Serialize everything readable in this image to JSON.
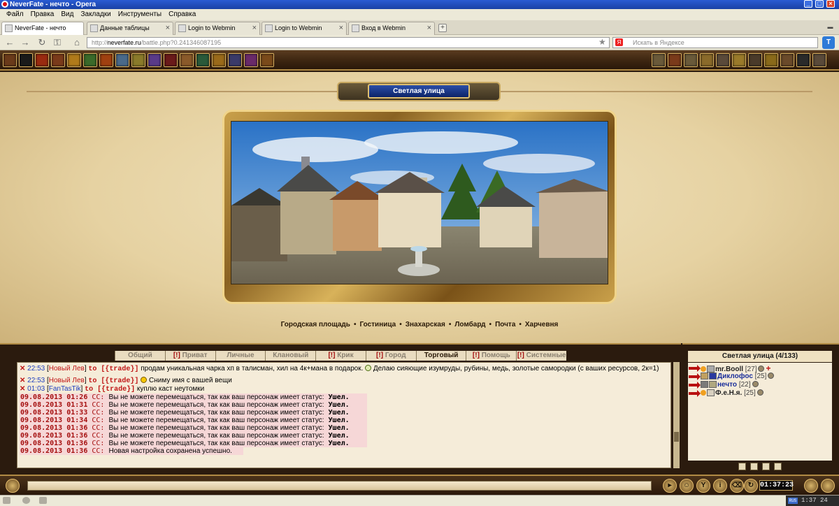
{
  "window": {
    "title": "NeverFate - нечто - Opera",
    "controls": [
      "_",
      "□",
      "×"
    ]
  },
  "menu": [
    "Файл",
    "Правка",
    "Вид",
    "Закладки",
    "Инструменты",
    "Справка"
  ],
  "tabs": [
    {
      "label": "NeverFate - нечто",
      "active": true
    },
    {
      "label": "Данные таблицы",
      "active": false
    },
    {
      "label": "Login to Webmin",
      "active": false
    },
    {
      "label": "Login to Webmin",
      "active": false
    },
    {
      "label": "Вход в Webmin",
      "active": false
    }
  ],
  "address": {
    "scheme": "http://",
    "host": "neverfate.ru",
    "path": "/battle.php?0.241346087195"
  },
  "search": {
    "placeholder": "Искать в Яндексе",
    "engine_letter": "Я"
  },
  "toolbar_button_letter": "T",
  "location": {
    "name": "Светлая улица",
    "links": [
      "Городская площадь",
      "Гостиница",
      "Знахарская",
      "Ломбард",
      "Почта",
      "Харчевня"
    ],
    "separator": "•"
  },
  "chat_tabs": [
    {
      "label": "Общий",
      "prefix": "",
      "active": false
    },
    {
      "label": "Приват",
      "prefix": "[!]",
      "active": false
    },
    {
      "label": "Личные",
      "prefix": "",
      "active": false
    },
    {
      "label": "Клановый",
      "prefix": "",
      "active": false
    },
    {
      "label": "Крик",
      "prefix": "[!]",
      "active": false
    },
    {
      "label": "Город",
      "prefix": "[!]",
      "active": false
    },
    {
      "label": "Торговый",
      "prefix": "",
      "active": true
    },
    {
      "label": "Помощь",
      "prefix": "[!]",
      "active": false
    },
    {
      "label": "Системные",
      "prefix": "[!]",
      "active": false
    }
  ],
  "chat": {
    "m1": {
      "time": "22:53",
      "nick": "Новый Лев",
      "to": "to [{trade}]",
      "text": " продам уникальная чарка хп в талисман, хил на 4к+мана в подарок. ",
      "text2": " Делаю сияющие изумруды, рубины, медь, золотые самородки (с ваших ресурсов, 2к=1) "
    },
    "m2": {
      "time": "22:53",
      "nick": "Новый Лев",
      "to": "to [{trade}]",
      "text": " Сниму имя с вашей вещи"
    },
    "m3": {
      "time": "01:03",
      "nick": "FanTasTik",
      "to": "to [{trade}]",
      "text": " куплю каст неутомки"
    },
    "system": [
      {
        "date": "09.08.2013",
        "time": "01:26",
        "tag": "CC:",
        "msg": "Вы не можете перемещаться, так как ваш персонаж имеет статус:",
        "status": "Ушел"
      },
      {
        "date": "09.08.2013",
        "time": "01:31",
        "tag": "CC:",
        "msg": "Вы не можете перемещаться, так как ваш персонаж имеет статус:",
        "status": "Ушел"
      },
      {
        "date": "09.08.2013",
        "time": "01:33",
        "tag": "CC:",
        "msg": "Вы не можете перемещаться, так как ваш персонаж имеет статус:",
        "status": "Ушел"
      },
      {
        "date": "09.08.2013",
        "time": "01:34",
        "tag": "CC:",
        "msg": "Вы не можете перемещаться, так как ваш персонаж имеет статус:",
        "status": "Ушел"
      },
      {
        "date": "09.08.2013",
        "time": "01:36",
        "tag": "CC:",
        "msg": "Вы не можете перемещаться, так как ваш персонаж имеет статус:",
        "status": "Ушел"
      },
      {
        "date": "09.08.2013",
        "time": "01:36",
        "tag": "CC:",
        "msg": "Вы не можете перемещаться, так как ваш персонаж имеет статус:",
        "status": "Ушел"
      },
      {
        "date": "09.08.2013",
        "time": "01:36",
        "tag": "CC:",
        "msg": "Вы не можете перемещаться, так как ваш персонаж имеет статус:",
        "status": "Ушел"
      },
      {
        "date": "09.08.2013",
        "time": "01:36",
        "tag": "CC:",
        "msg": "Новая настройка сохранена успешно.",
        "status": ""
      }
    ]
  },
  "users": {
    "header": "Светлая улица (4/133)",
    "list": [
      {
        "name": "mr.Booll",
        "level": "[27]",
        "name_color": "dark",
        "cross": "+"
      },
      {
        "name": "Диклофос",
        "level": "[25]",
        "name_color": "blue",
        "cross": ""
      },
      {
        "name": "нечто",
        "level": "[22]",
        "name_color": "blue",
        "cross": ""
      },
      {
        "name": "Ф.е.Н.я.",
        "level": "[25]",
        "name_color": "dark",
        "cross": ""
      }
    ]
  },
  "bottom": {
    "clock": "01:37:23"
  },
  "tray": {
    "lang": "RUS",
    "time": "1:37 24"
  }
}
